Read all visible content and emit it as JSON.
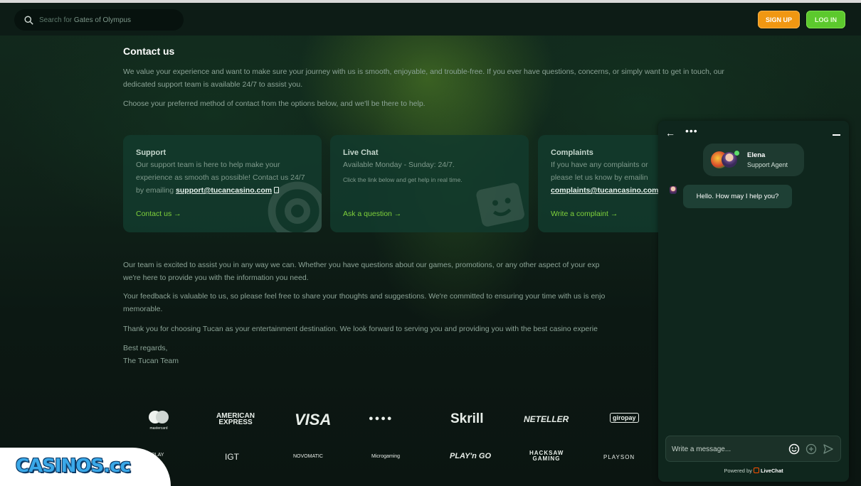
{
  "header": {
    "search_prefix": "Search for",
    "search_term": "Gates of Olympus",
    "signup_label": "SIGN UP",
    "login_label": "LOG IN"
  },
  "page": {
    "title": "Contact us",
    "intro": "We value your experience and want to make sure your journey with us is smooth, enjoyable, and trouble-free. If you ever have questions, concerns, or simply want to get in touch, our dedicated support team is available 24/7 to assist you.",
    "choose": "Choose your preferred method of contact from the options below, and we'll be there to help.",
    "outro_1_l1": "Our team is excited to assist you in any way we can. Whether you have questions about our games, promotions, or any other aspect of your exp",
    "outro_1_l2": "we're here to provide you with the information you need.",
    "outro_2_l1": "Your feedback is valuable to us, so please feel free to share your thoughts and suggestions. We're committed to ensuring your time with us is enjo",
    "outro_2_l2": "memorable.",
    "outro_3": "Thank you for choosing Tucan as your entertainment destination. We look forward to serving you and providing you with the best casino experie",
    "sign_1": "Best regards,",
    "sign_2": "The Tucan Team"
  },
  "cards": {
    "support": {
      "title": "Support",
      "text": "Our support team is here to help make your experience as smooth as possible! Contact us 24/7 by emailing",
      "email": "support@tucancasino.com",
      "link": "Contact us →"
    },
    "livechat": {
      "title": "Live Chat",
      "text": "Available Monday - Sunday: 24/7.",
      "small": "Click the link below and get help in real time.",
      "link": "Ask a question →"
    },
    "complaints": {
      "title": "Complaints",
      "text": "If you have any complaints or please let us know by emailin",
      "email": "complaints@tucancasino.com",
      "link": "Write a complaint →"
    }
  },
  "payments": {
    "row1": [
      "mastercard",
      "AMERICAN EXPRESS",
      "VISA",
      "",
      "Skrill",
      "NETELLER",
      "giropay"
    ],
    "row2": [
      "PRAGMATIC PLAY",
      "IGT",
      "NOVOMATIC",
      "Microgaming",
      "PLAY'n GO",
      "HACKSAW GAMING",
      "PLAYSON"
    ]
  },
  "badge": {
    "text": "CASINOS.cc"
  },
  "chat": {
    "agent_name": "Elena",
    "agent_role": "Support Agent",
    "message": "Hello. How may I help you?",
    "input_placeholder": "Write a message...",
    "powered_prefix": "Powered by",
    "powered_brand": "LiveChat"
  },
  "colors": {
    "signup": "#f09712",
    "login": "#5cc92d",
    "link_green": "#7fd13b",
    "card_bg": "#123a2c"
  }
}
